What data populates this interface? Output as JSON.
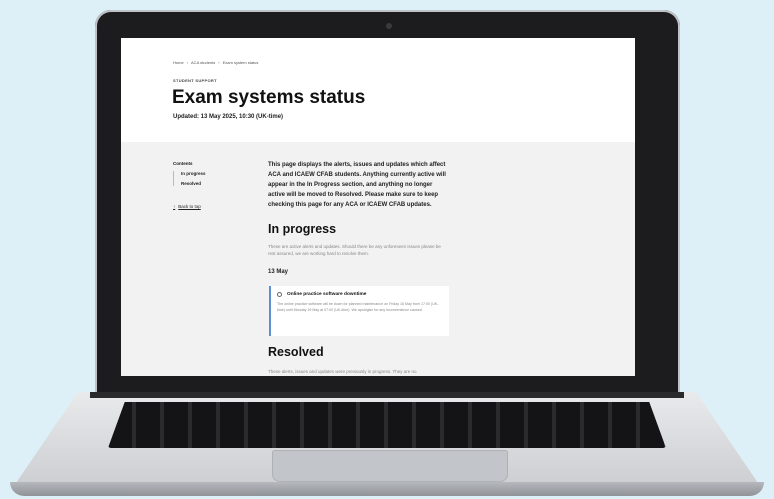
{
  "page": {
    "breadcrumb": [
      "Home",
      "›",
      "ACA students",
      "›",
      "Exam system status"
    ],
    "eyebrow": "STUDENT SUPPORT",
    "title": "Exam systems status",
    "updated": "Updated: 13 May 2025, 10:30 (UK-time)"
  },
  "sidebar": {
    "heading": "Contents",
    "items": [
      "In progress",
      "Resolved"
    ],
    "back_to_top": "Back to top"
  },
  "main": {
    "intro": "This page displays the alerts, issues and updates which affect ACA and ICAEW CFAB students. Anything currently active will appear in the In Progress section, and anything no longer active will be moved to Resolved. Please make sure to keep checking this page for any ACA or ICAEW CFAB updates.",
    "in_progress_heading": "In progress",
    "in_progress_text": "These are active alerts and updates. Should there be any unforeseen issues please be rest assured, we are working hard to resolve them.",
    "date": "13 May",
    "card": {
      "title": "Online practice software downtime",
      "text": "The online practice software will be down for planned maintenance on Friday 16 May from 17:00 (UK-time) until Monday 19 May at 07:00 (UK-time). We apologise for any inconvenience caused."
    },
    "resolved_heading": "Resolved",
    "resolved_text": "These alerts, issues and updates were previously in progress. They are no"
  },
  "colors": {
    "background": "#ddeff7",
    "card_accent": "#5a8fd6",
    "laptop_bezel": "#1c1c1e"
  }
}
